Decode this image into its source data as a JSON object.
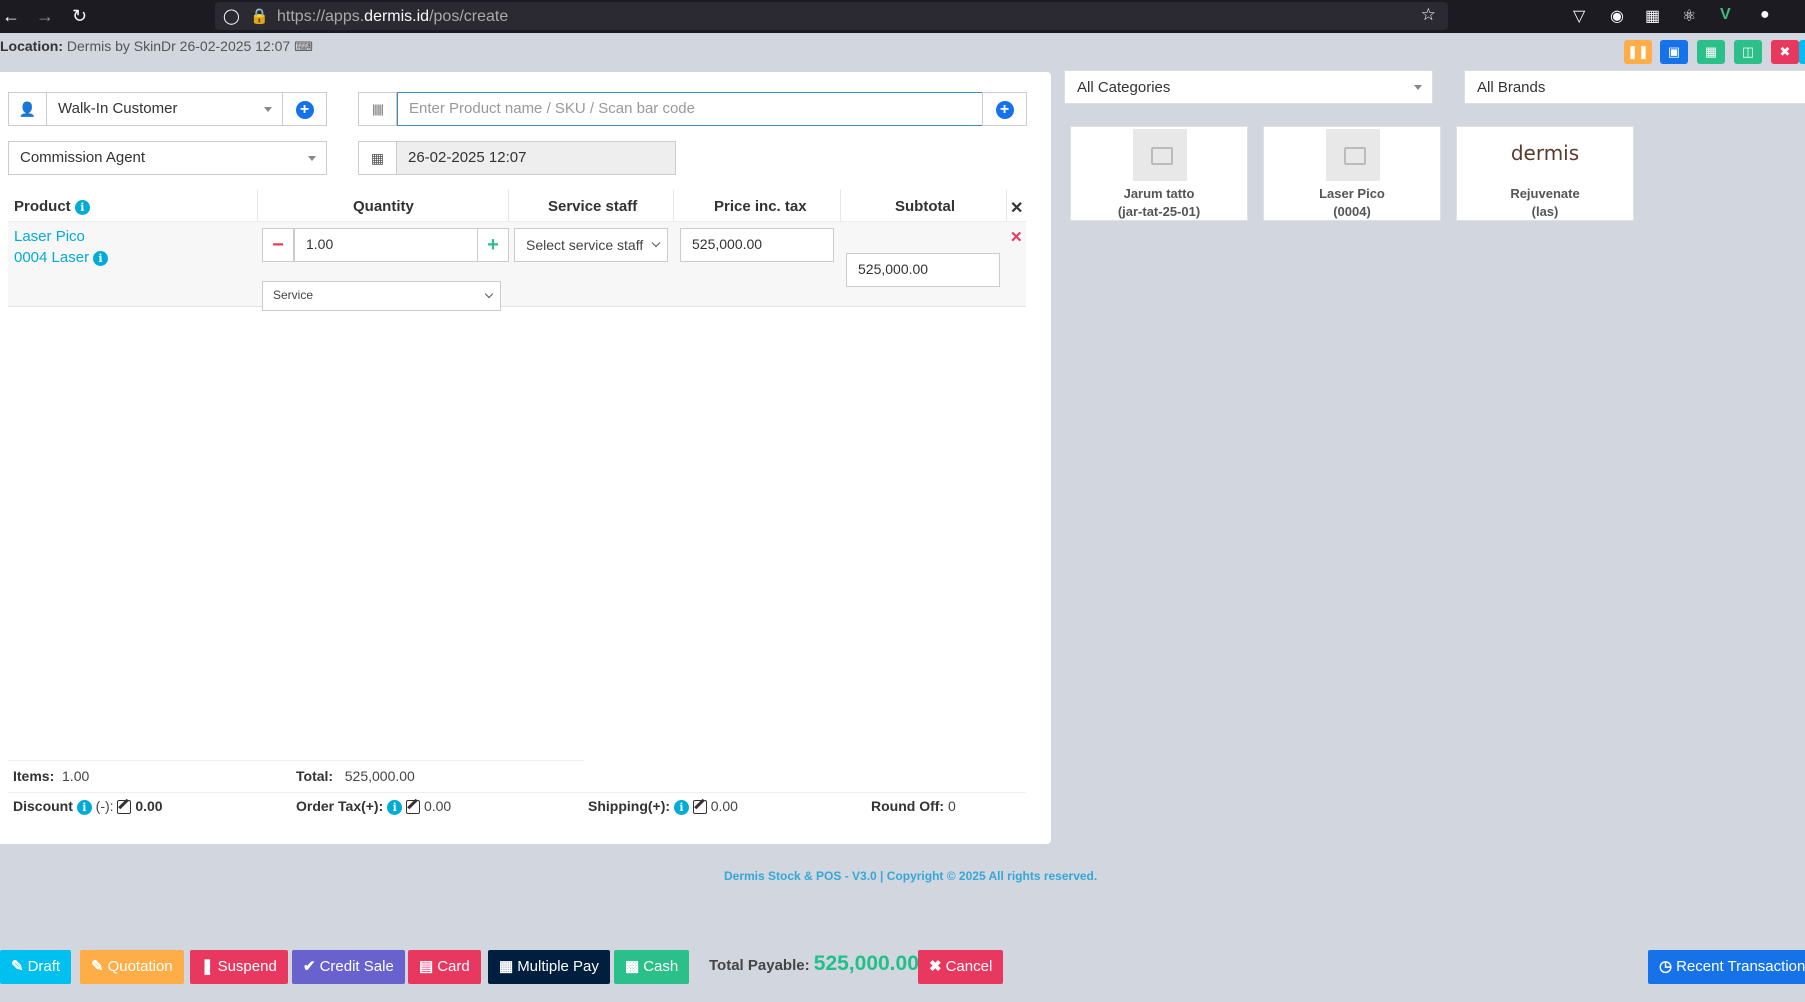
{
  "browser": {
    "url_prefix": "https://apps.",
    "url_domain": "dermis.id",
    "url_path": "/pos/create"
  },
  "location": {
    "label": "Location:",
    "value": "Dermis by SkinDr 26-02-2025 12:07"
  },
  "form": {
    "customer": "Walk-In Customer",
    "product_search_placeholder": "Enter Product name / SKU / Scan bar code",
    "commission_agent": "Commission Agent",
    "date": "26-02-2025 12:07"
  },
  "table": {
    "headers": {
      "product": "Product",
      "quantity": "Quantity",
      "service_staff": "Service staff",
      "price": "Price inc. tax",
      "subtotal": "Subtotal"
    },
    "rows": [
      {
        "product_name": "Laser Pico",
        "product_sku": "0004 Laser",
        "quantity": "1.00",
        "unit": "Service",
        "service_staff": "Select service staff",
        "price": "525,000.00",
        "subtotal": "525,000.00"
      }
    ]
  },
  "totals": {
    "items_label": "Items:",
    "items_value": "1.00",
    "total_label": "Total:",
    "total_value": "525,000.00",
    "discount_label": "Discount",
    "discount_suffix": "(-):",
    "discount_value": "0.00",
    "order_tax_label": "Order Tax(+):",
    "order_tax_value": "0.00",
    "shipping_label": "Shipping(+):",
    "shipping_value": "0.00",
    "round_off_label": "Round Off:",
    "round_off_value": "0"
  },
  "filters": {
    "categories": "All Categories",
    "brands": "All Brands"
  },
  "products": [
    {
      "name": "Jarum tatto",
      "sku": "(jar-tat-25-01)"
    },
    {
      "name": "Laser Pico",
      "sku": "(0004)"
    },
    {
      "name": "Rejuvenate",
      "sku": "(las)",
      "logo": "dermis"
    }
  ],
  "footer": {
    "copyright": "Dermis Stock & POS - V3.0 | Copyright © 2025 All rights reserved."
  },
  "actions": {
    "draft": "Draft",
    "quotation": "Quotation",
    "suspend": "Suspend",
    "credit_sale": "Credit Sale",
    "card": "Card",
    "multiple_pay": "Multiple Pay",
    "cash": "Cash",
    "total_payable_label": "Total Payable:",
    "total_payable_value": "525,000.00",
    "cancel": "Cancel",
    "recent_transactions": "Recent Transactions"
  },
  "colors": {
    "draft": "#00c0ef",
    "quotation": "#ffad46",
    "suspend": "#e8385f",
    "credit_sale": "#6861ce",
    "card": "#e8385f",
    "multiple_pay": "#001f3f",
    "cash": "#2bbf8a",
    "cancel": "#e8385f",
    "recent": "#1572e8"
  }
}
